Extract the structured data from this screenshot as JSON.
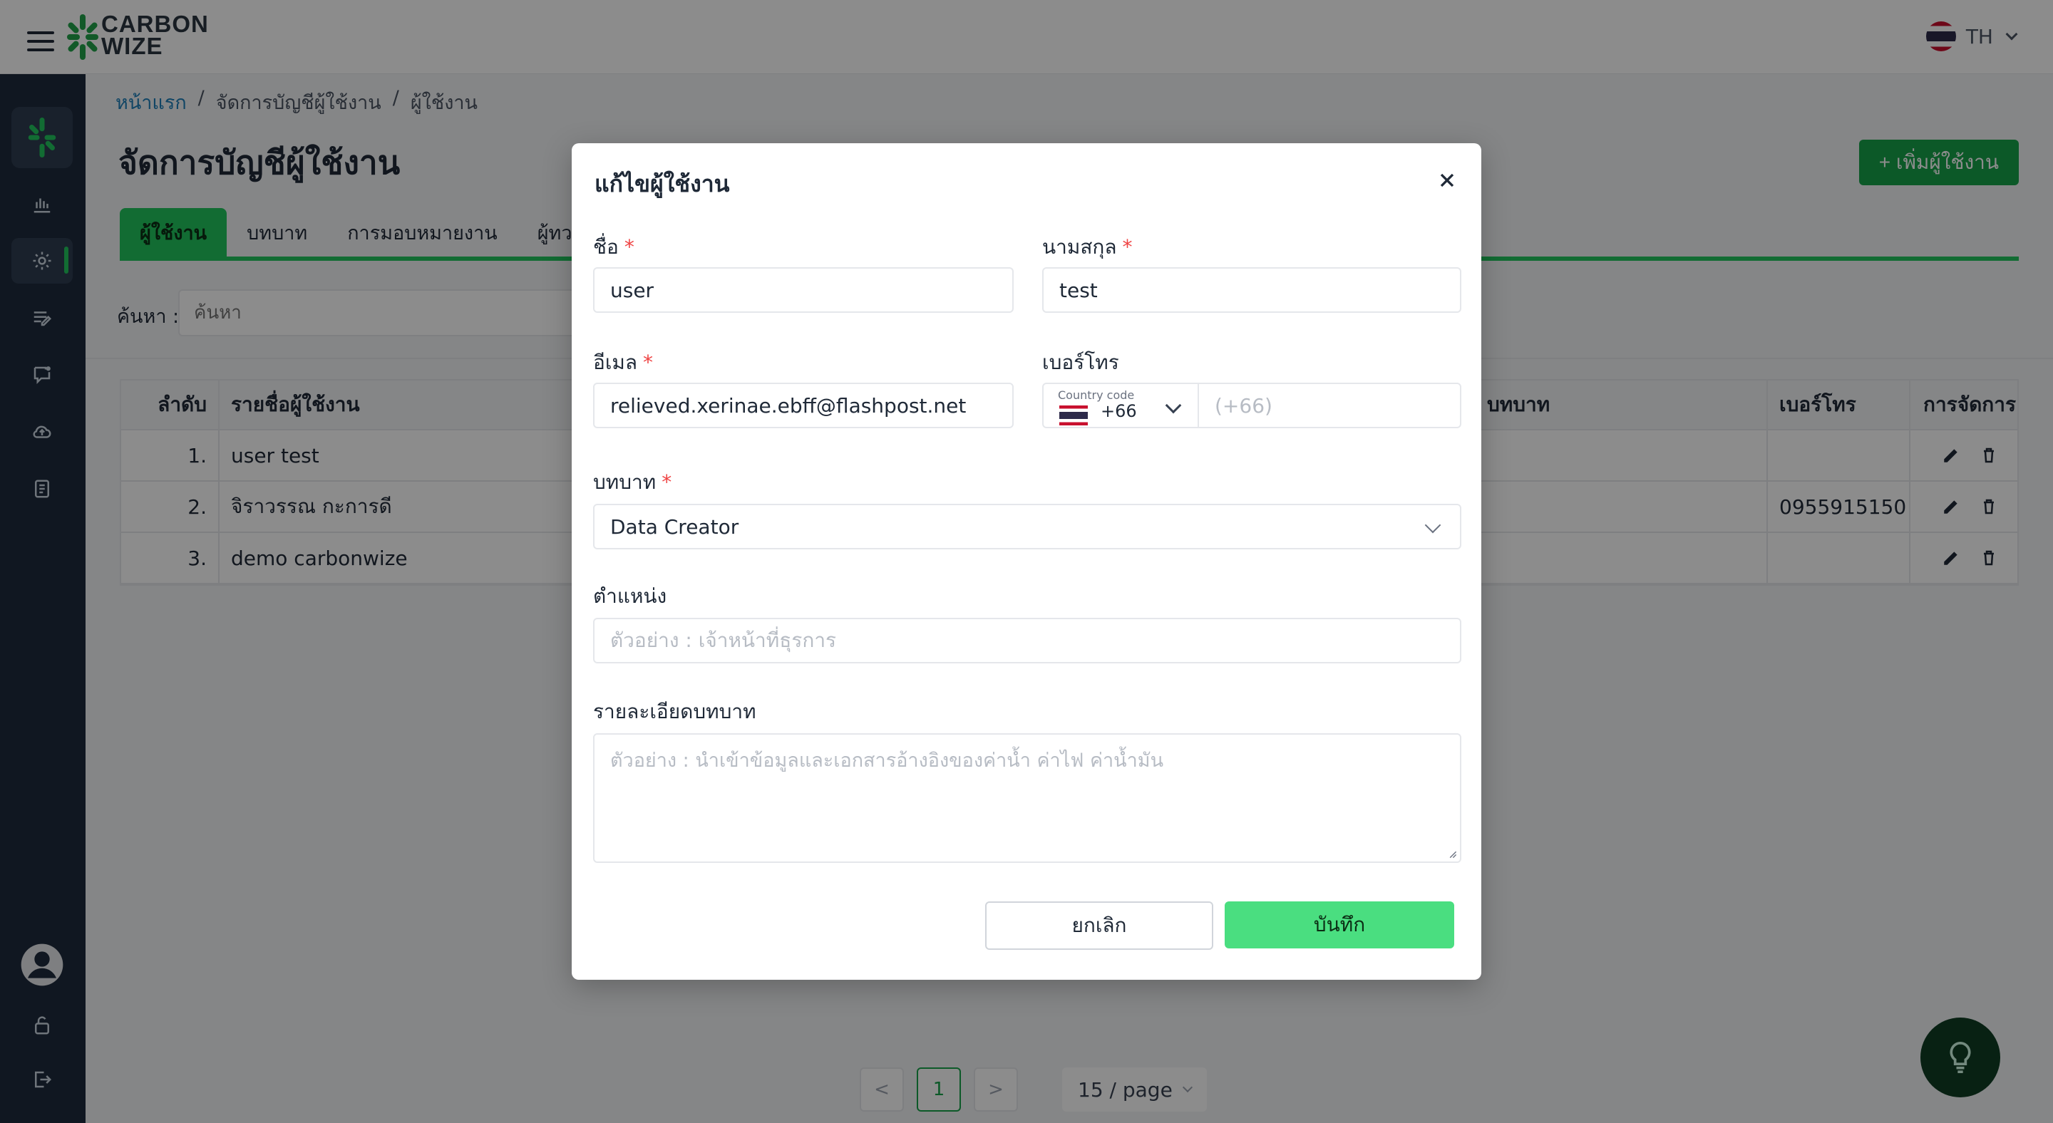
{
  "header": {
    "brand_line1": "CARBON",
    "brand_line2": "WIZE",
    "language": "TH"
  },
  "breadcrumb": [
    "หน้าแรก",
    "จัดการบัญชีผู้ใช้งาน",
    "ผู้ใช้งาน"
  ],
  "breadcrumb_separator": "/",
  "page": {
    "title": "จัดการบัญชีผู้ใช้งาน",
    "add_button": "+ เพิ่มผู้ใช้งาน",
    "tabs": [
      "ผู้ใช้งาน",
      "บทบาท",
      "การมอบหมายงาน",
      "ผู้ทวนส"
    ],
    "search_label": "ค้นหา :",
    "search_placeholder": "ค้นหา"
  },
  "table": {
    "headers": {
      "index": "ลำดับ",
      "name": "รายชื่อผู้ใช้งาน",
      "role": "บทบาท",
      "phone": "เบอร์โทร",
      "actions": "การจัดการ"
    },
    "rows": [
      {
        "index": "1.",
        "name": "user test",
        "role": "",
        "phone": ""
      },
      {
        "index": "2.",
        "name": "จิราวรรณ กะการดี",
        "role": "",
        "phone": "0955915150"
      },
      {
        "index": "3.",
        "name": "demo carbonwize",
        "role": "",
        "phone": ""
      }
    ]
  },
  "pagination": {
    "prev": "<",
    "current": "1",
    "next": ">",
    "page_size": "15 / page"
  },
  "modal": {
    "title": "แก้ไขผู้ใช้งาน",
    "first_name_label": "ชื่อ",
    "first_name_value": "user",
    "last_name_label": "นามสกุล",
    "last_name_value": "test",
    "email_label": "อีเมล",
    "email_value": "relieved.xerinae.ebff@flashpost.net",
    "phone_label": "เบอร์โทร",
    "country_code_label": "Country code",
    "country_code_value": "+66",
    "phone_placeholder": "(+66)",
    "role_label": "บทบาท",
    "role_value": "Data Creator",
    "position_label": "ตำแหน่ง",
    "position_placeholder": "ตัวอย่าง : เจ้าหน้าที่ธุรการ",
    "role_detail_label": "รายละเอียดบทบาท",
    "role_detail_placeholder": "ตัวอย่าง : นำเข้าข้อมูลและเอกสารอ้างอิงของค่าน้ำ ค่าไฟ ค่าน้ำมัน",
    "required_mark": "*",
    "cancel_button": "ยกเลิก",
    "save_button": "บันทึก"
  },
  "colors": {
    "brand_green": "#22c55e",
    "sidebar_bg": "#1e2b3c",
    "save_button": "#4ade80",
    "required": "#ef4444"
  }
}
